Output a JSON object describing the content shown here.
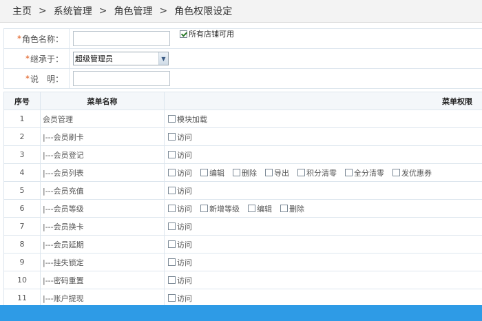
{
  "breadcrumb": [
    "主页",
    "系统管理",
    "角色管理",
    "角色权限设定"
  ],
  "breadcrumb_sep": ">",
  "form": {
    "role_name_label": "角色名称：",
    "role_name_value": "",
    "all_stores_label": "所有店铺可用",
    "all_stores_checked": true,
    "inherit_label": "继承于：",
    "inherit_value": "超级管理员",
    "desc_label": "说　明：",
    "desc_value": "",
    "required_mark": "*"
  },
  "grid": {
    "headers": [
      "序号",
      "菜单名称",
      "菜单权限"
    ],
    "rows": [
      {
        "idx": "1",
        "name": "会员管理",
        "perms": [
          "模块加载"
        ]
      },
      {
        "idx": "2",
        "name": "|---会员刷卡",
        "perms": [
          "访问"
        ]
      },
      {
        "idx": "3",
        "name": "|---会员登记",
        "perms": [
          "访问"
        ]
      },
      {
        "idx": "4",
        "name": "|---会员列表",
        "perms": [
          "访问",
          "编辑",
          "删除",
          "导出",
          "积分清零",
          "全分清零",
          "发优惠券"
        ]
      },
      {
        "idx": "5",
        "name": "|---会员充值",
        "perms": [
          "访问"
        ]
      },
      {
        "idx": "6",
        "name": "|---会员等级",
        "perms": [
          "访问",
          "新增等级",
          "编辑",
          "删除"
        ]
      },
      {
        "idx": "7",
        "name": "|---会员换卡",
        "perms": [
          "访问"
        ]
      },
      {
        "idx": "8",
        "name": "|---会员延期",
        "perms": [
          "访问"
        ]
      },
      {
        "idx": "9",
        "name": "|---挂失锁定",
        "perms": [
          "访问"
        ]
      },
      {
        "idx": "10",
        "name": "|---密码重置",
        "perms": [
          "访问"
        ]
      },
      {
        "idx": "11",
        "name": "|---账户提现",
        "perms": [
          "访问"
        ]
      }
    ]
  },
  "colors": {
    "accent": "#2e9be6",
    "required": "#e05a1a"
  }
}
